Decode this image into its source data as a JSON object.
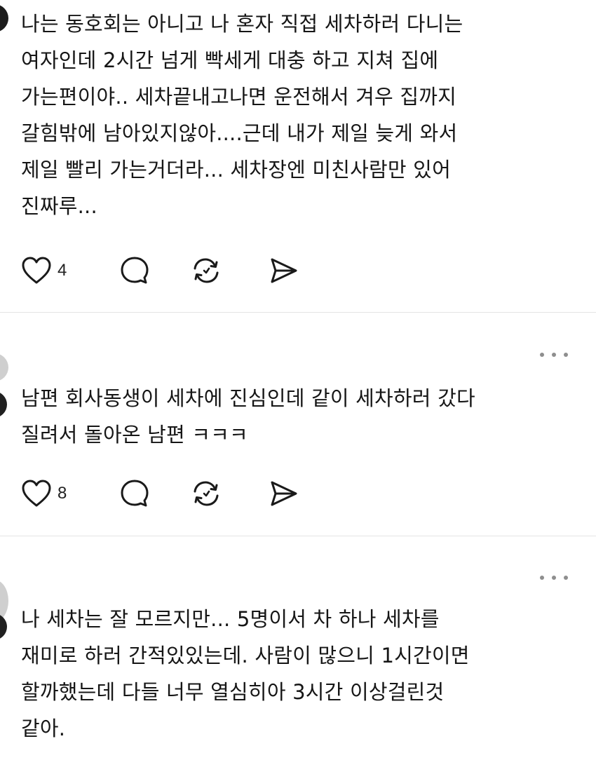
{
  "posts": [
    {
      "lines": [
        "나는 동호회는 아니고 나 혼자 직접 세차하러 다니는",
        "여자인데 2시간 넘게 빡세게 대충 하고 지쳐 집에",
        "가는편이야.. 세차끝내고나면 운전해서 겨우 집까지",
        "갈힘밖에 남아있지않아....근데 내가 제일 늦게 와서",
        "제일 빨리 가는거더라... 세차장엔 미친사람만 있어",
        "진짜루..."
      ],
      "like_count": "4"
    },
    {
      "lines": [
        "남편 회사동생이 세차에 진심인데 같이 세차하러 갔다",
        "질려서 돌아온 남편 ㅋㅋㅋ"
      ],
      "like_count": "8"
    },
    {
      "lines": [
        "나 세차는 잘 모르지만... 5명이서 차 하나 세차를",
        "재미로 하러 간적있있는데. 사람이 많으니 1시간이면",
        "할까했는데 다들 너무 열심히아 3시간 이상걸린것",
        "같아."
      ]
    }
  ],
  "icons": {
    "like": "heart-icon",
    "comment": "comment-bubble-icon",
    "repost": "repost-icon",
    "share": "send-icon",
    "more": "more-horizontal-icon"
  }
}
